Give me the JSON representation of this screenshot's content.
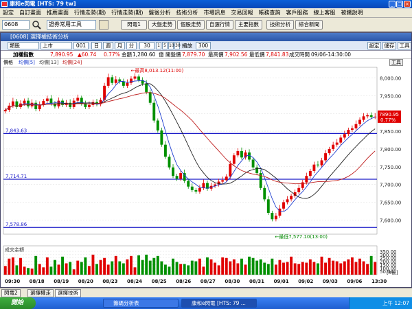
{
  "window": {
    "title": "康和e閃電 [HTS: 79 tw]"
  },
  "menu": [
    "設定",
    "自訂畫面",
    "推薦畫面",
    "行情走勢(期)",
    "行情走勢(期)",
    "盤後分析",
    "技術分析",
    "市場訊息",
    "交易回報",
    "帳務查詢",
    "客戶服務",
    "線上客服",
    "被鐵說明"
  ],
  "toolbar": {
    "symbol": "0608",
    "tool_select": "證券常用工具",
    "buttons": [
      "閃電1",
      "大盤走勢",
      "個股走勢",
      "自選行情",
      "主要指數",
      "技術分析",
      "綜合新聞"
    ]
  },
  "chart_window": {
    "title": "[0608] 選擇權技術分析",
    "market": "類股",
    "exchange": "上市",
    "code": "001",
    "periods": [
      "日",
      "週",
      "月",
      "分"
    ],
    "period_value": "30",
    "steps": [
      "1",
      "5",
      "10",
      "30"
    ],
    "zoom_label": "縮放",
    "zoom_value": "300",
    "right_buttons": [
      "設定",
      "儲存",
      "工具"
    ]
  },
  "info": {
    "name": "加權指數",
    "last": "7,890.95",
    "change": "▲60.74",
    "pct": "0.77%",
    "amount_label": "金額",
    "amount": "1,280.60",
    "unit": "億",
    "open_label": "開盤價",
    "open": "7,879.70",
    "high_label": "最高價",
    "high": "7,902.56",
    "low_label": "最低價",
    "low": "7,841.83",
    "time_label": "成交時間",
    "time": "09/06-14:30:00"
  },
  "legend": {
    "price": "價格",
    "ma5": "均價[5]",
    "ma13": "均價[13]",
    "ma24": "均價[24]",
    "tool_tag": "工具"
  },
  "chart_data": {
    "type": "candlestick",
    "price_axis": {
      "min": 7560,
      "max": 8030,
      "ticks": [
        "8,000.00",
        "7,950.00",
        "7,900.00",
        "7,850.00",
        "7,800.00",
        "7,750.00",
        "7,700.00",
        "7,650.00",
        "7,600.00"
      ]
    },
    "hlines": [
      {
        "label": "7,843.63",
        "value": 7843.63
      },
      {
        "label": "7,714.71",
        "value": 7714.71
      },
      {
        "label": "7,578.86",
        "value": 7578.86
      }
    ],
    "annotations": {
      "high": "最高8,013.12(11:00)",
      "low": "最低7,577.10(13:00)",
      "last_tag": "7890.95",
      "last_pct": "0.77%"
    },
    "closes": [
      7910,
      7922,
      7934,
      7918,
      7928,
      7936,
      7920,
      7930,
      7912,
      7925,
      7935,
      7942,
      7928,
      7920,
      7936,
      7924,
      7930,
      7918,
      7936,
      7944,
      7928,
      7918,
      7924,
      7932,
      7926,
      7938,
      7978,
      8002,
      7986,
      7996,
      7990,
      7978,
      7986,
      7998,
      8004,
      7994,
      7984,
      7960,
      7930,
      7880,
      7852,
      7812,
      7778,
      7748,
      7724,
      7716,
      7732,
      7710,
      7694,
      7684,
      7680,
      7690,
      7704,
      7688,
      7696,
      7700,
      7708,
      7712,
      7722,
      7758,
      7782,
      7794,
      7776,
      7790,
      7770,
      7748,
      7732,
      7690,
      7658,
      7620,
      7602,
      7612,
      7632,
      7650,
      7658,
      7668,
      7678,
      7690,
      7706,
      7724,
      7738,
      7756,
      7754,
      7768,
      7788,
      7800,
      7812,
      7818,
      7832,
      7842,
      7854,
      7858,
      7870,
      7882,
      7892,
      7895,
      7890,
      7891
    ],
    "volume_label": "成交金額",
    "volume_axis": {
      "max": 350,
      "ticks": [
        "350.00",
        "300.00",
        "250.00",
        "200.00",
        "150.00",
        "100.00",
        "50.00"
      ],
      "unit": "[x億]"
    },
    "volumes": [
      130,
      240,
      260,
      140,
      250,
      120,
      100,
      90,
      280,
      160,
      110,
      260,
      120,
      220,
      150,
      270,
      170,
      190,
      80,
      210,
      190,
      260,
      130,
      300,
      160,
      220,
      250,
      150,
      200,
      280,
      200,
      170,
      230,
      280,
      110,
      290,
      220,
      300,
      210,
      250,
      280,
      200,
      150,
      120,
      240,
      190,
      160,
      160,
      140,
      210,
      200,
      240,
      120,
      260,
      230,
      180,
      140,
      260,
      250,
      200,
      230,
      170,
      240,
      150,
      270,
      250,
      210,
      230,
      180,
      160,
      240,
      150,
      220,
      180,
      190,
      270,
      170,
      160,
      190,
      180,
      230,
      190,
      170,
      270,
      180,
      250,
      210,
      200,
      170,
      200,
      230,
      260,
      190,
      240,
      200,
      160,
      280,
      190
    ],
    "x_labels": [
      "09:30",
      "08/18",
      "08/19",
      "08/20",
      "08/23",
      "08/24",
      "08/25",
      "08/26",
      "08/27",
      "08/30",
      "08/31",
      "09/01",
      "09/02",
      "09/03",
      "09/06",
      "13:30"
    ]
  },
  "bottom_tabs": [
    "閃電2",
    "選擇權走",
    "選擇技術"
  ],
  "taskbar": {
    "start": "開始",
    "tasks": [
      "籌碼分析表",
      "康和e閃電 [HTS: 79 ..."
    ],
    "clock": "上午 12:07"
  }
}
